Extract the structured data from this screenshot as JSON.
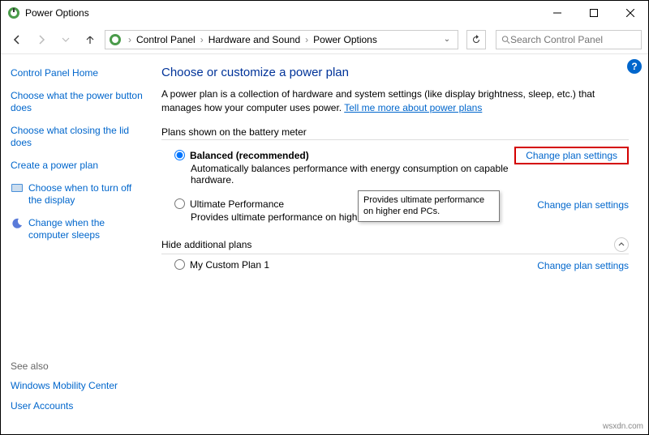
{
  "window": {
    "title": "Power Options"
  },
  "breadcrumb": {
    "items": [
      "Control Panel",
      "Hardware and Sound",
      "Power Options"
    ]
  },
  "search": {
    "placeholder": "Search Control Panel"
  },
  "sidebar": {
    "home": "Control Panel Home",
    "links": [
      "Choose what the power button does",
      "Choose what closing the lid does",
      "Create a power plan",
      "Choose when to turn off the display",
      "Change when the computer sleeps"
    ]
  },
  "see_also": {
    "heading": "See also",
    "links": [
      "Windows Mobility Center",
      "User Accounts"
    ]
  },
  "main": {
    "heading": "Choose or customize a power plan",
    "description": "A power plan is a collection of hardware and system settings (like display brightness, sleep, etc.) that manages how your computer uses power. ",
    "learn_more": "Tell me more about power plans",
    "plans_label": "Plans shown on the battery meter",
    "plans": [
      {
        "name": "Balanced (recommended)",
        "sub": "Automatically balances performance with energy consumption on capable hardware.",
        "link": "Change plan settings",
        "selected": true
      },
      {
        "name": "Ultimate Performance",
        "sub": "Provides ultimate performance on higher en",
        "link": "Change plan settings",
        "selected": false
      }
    ],
    "hide_label": "Hide additional plans",
    "hidden_plan": {
      "name": "My Custom Plan 1",
      "link": "Change plan settings"
    },
    "tooltip": "Provides ultimate performance on higher end PCs."
  },
  "watermark": "wsxdn.com"
}
